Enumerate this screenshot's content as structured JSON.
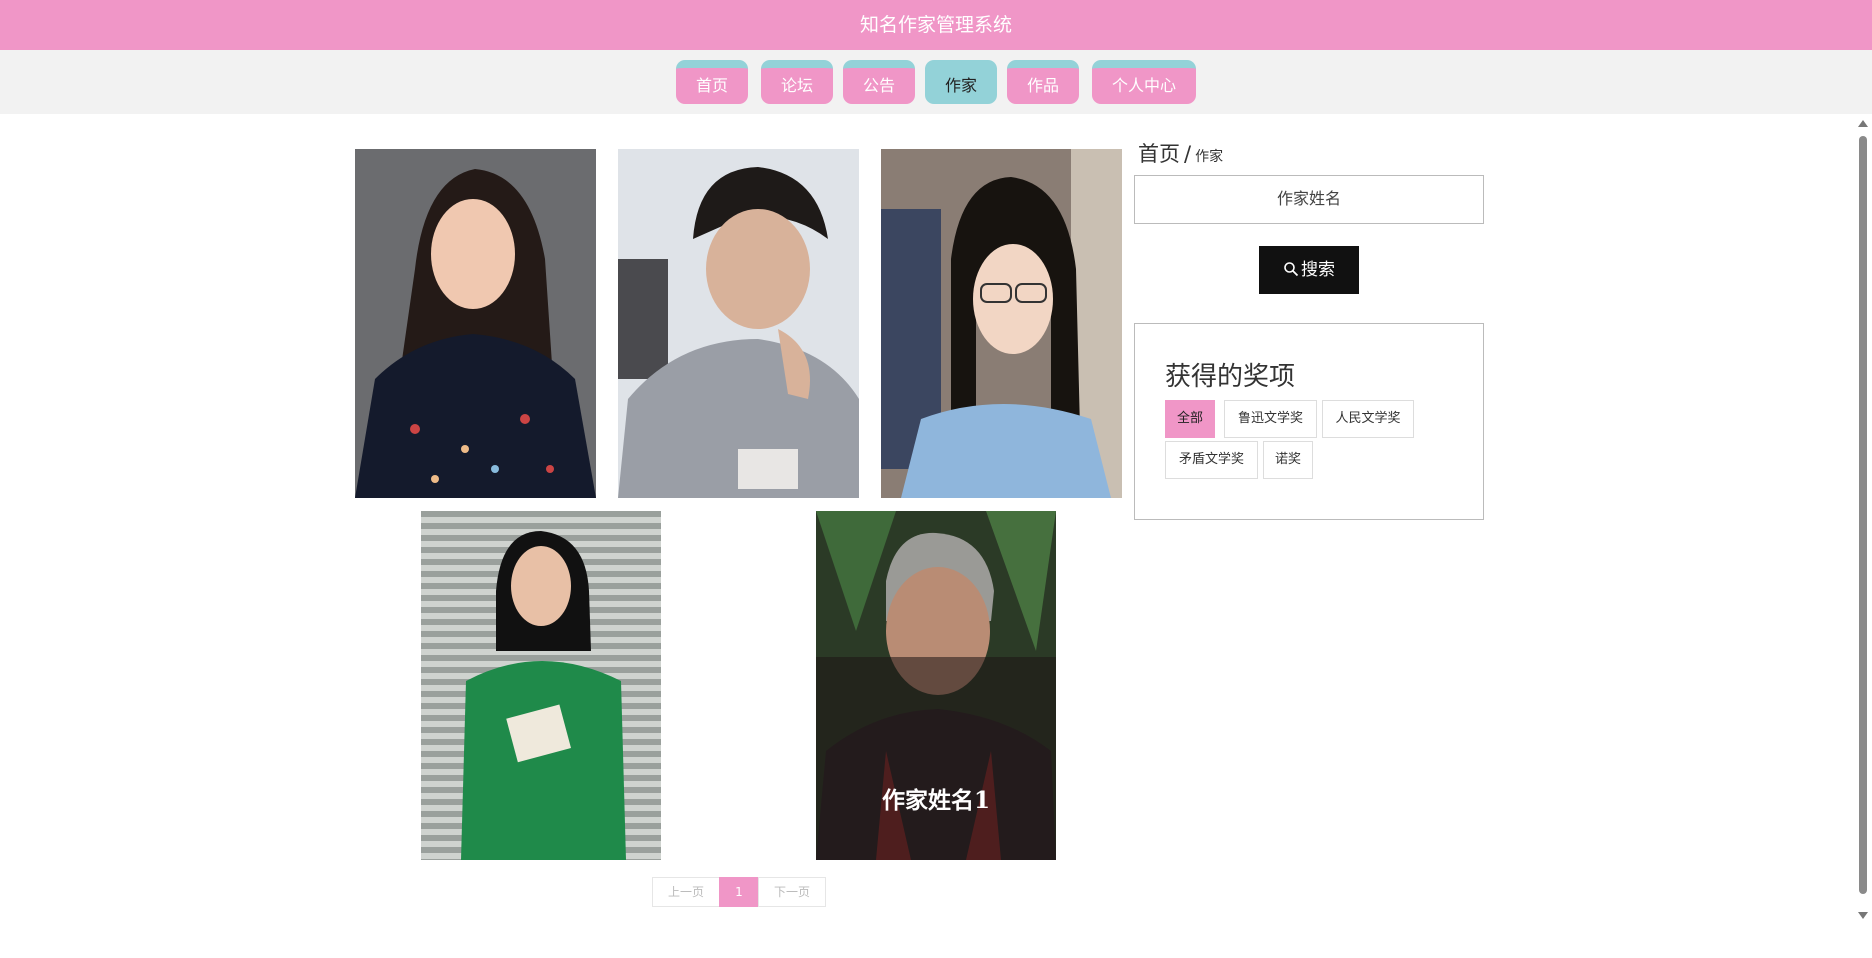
{
  "header": {
    "title": "知名作家管理系统"
  },
  "nav": [
    {
      "label": "首页"
    },
    {
      "label": "论坛"
    },
    {
      "label": "公告"
    },
    {
      "label": "作家",
      "active": true
    },
    {
      "label": "作品"
    },
    {
      "label": "个人中心"
    }
  ],
  "breadcrumb": {
    "home": "首页",
    "separator": "/",
    "current": "作家"
  },
  "search": {
    "placeholder": "作家姓名",
    "button_label": "搜索",
    "icon": "search-icon"
  },
  "awards": {
    "title": "获得的奖项",
    "tags": [
      "全部",
      "鲁迅文学奖",
      "人民文学奖",
      "矛盾文学奖",
      "诺奖"
    ],
    "selected": "全部"
  },
  "writers": [
    {
      "image": "woman-floral-blouse-portrait"
    },
    {
      "image": "man-hand-on-chin-portrait"
    },
    {
      "image": "woman-glasses-long-hair-portrait"
    },
    {
      "image": "woman-green-dress-holding-book-portrait"
    },
    {
      "image": "elderly-man-portrait",
      "name": "作家姓名1"
    }
  ],
  "pagination": {
    "prev": "上一页",
    "current": "1",
    "next": "下一页"
  },
  "colors": {
    "primary_pink": "#f096c7",
    "accent_teal": "#93d2d8",
    "nav_bg": "#f2f2f2",
    "button_dark": "#111111"
  }
}
